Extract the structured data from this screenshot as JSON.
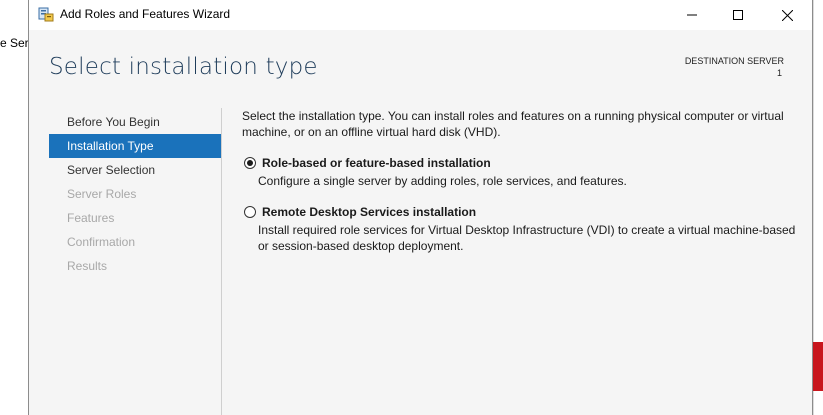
{
  "background": {
    "fragment_text": "e Ser"
  },
  "window": {
    "title": "Add Roles and Features Wizard",
    "icon": "server-manager-icon",
    "controls": {
      "minimize": "minimize-icon",
      "maximize": "maximize-icon",
      "close": "close-icon"
    }
  },
  "header": {
    "title": "Select installation type",
    "destination_label": "DESTINATION SERVER",
    "destination_value": "1"
  },
  "nav": {
    "items": [
      {
        "label": "Before You Begin",
        "state": "normal"
      },
      {
        "label": "Installation Type",
        "state": "active"
      },
      {
        "label": "Server Selection",
        "state": "normal"
      },
      {
        "label": "Server Roles",
        "state": "disabled"
      },
      {
        "label": "Features",
        "state": "disabled"
      },
      {
        "label": "Confirmation",
        "state": "disabled"
      },
      {
        "label": "Results",
        "state": "disabled"
      }
    ]
  },
  "content": {
    "intro": "Select the installation type. You can install roles and features on a running physical computer or virtual machine, or on an offline virtual hard disk (VHD).",
    "options": [
      {
        "label": "Role-based or feature-based installation",
        "description": "Configure a single server by adding roles, role services, and features.",
        "selected": true
      },
      {
        "label": "Remote Desktop Services installation",
        "description": "Install required role services for Virtual Desktop Infrastructure (VDI) to create a virtual machine-based or session-based desktop deployment.",
        "selected": false
      }
    ]
  },
  "colors": {
    "accent": "#1a72bb",
    "header_title": "#1e3c5a",
    "disabled_text": "#a8a8a8",
    "background_red": "#c8161d"
  }
}
